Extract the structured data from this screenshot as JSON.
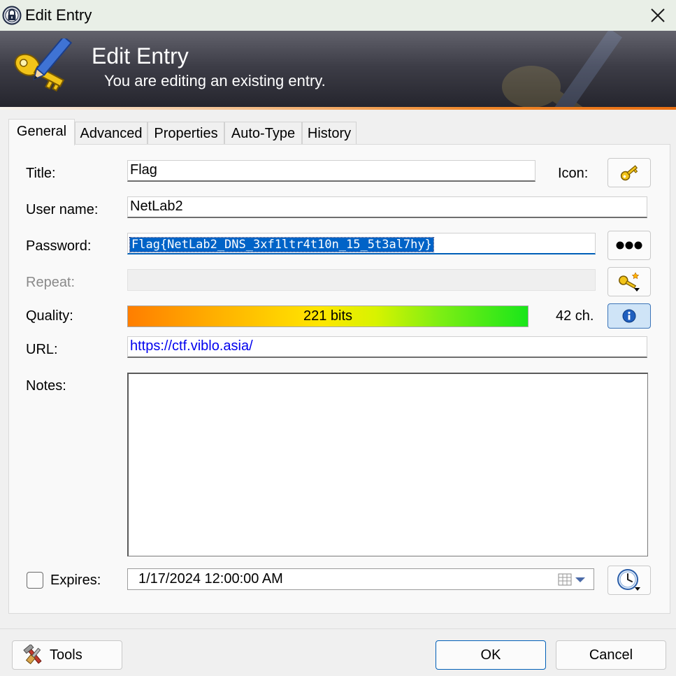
{
  "window": {
    "title": "Edit Entry"
  },
  "banner": {
    "title": "Edit Entry",
    "subtitle": "You are editing an existing entry."
  },
  "tabs": [
    {
      "label": "General",
      "active": true
    },
    {
      "label": "Advanced",
      "active": false
    },
    {
      "label": "Properties",
      "active": false
    },
    {
      "label": "Auto-Type",
      "active": false
    },
    {
      "label": "History",
      "active": false
    }
  ],
  "form": {
    "title_label": "Title:",
    "title_value": "Flag",
    "icon_label": "Icon:",
    "username_label": "User name:",
    "username_value": "NetLab2",
    "password_label": "Password:",
    "password_value": "Flag{NetLab2_DNS_3xf1ltr4t10n_15_5t3al7hy}",
    "repeat_label": "Repeat:",
    "repeat_value": "",
    "quality_label": "Quality:",
    "quality_bits": "221 bits",
    "quality_chars": "42 ch.",
    "url_label": "URL:",
    "url_value": "https://ctf.viblo.asia/",
    "notes_label": "Notes:",
    "notes_value": "",
    "expires_label": "Expires:",
    "expires_checked": false,
    "expires_value": "1/17/2024 12:00:00 AM"
  },
  "buttons": {
    "tools": "Tools",
    "ok": "OK",
    "cancel": "Cancel"
  },
  "colors": {
    "accent": "#005fb8",
    "url": "#0000ee",
    "selection": "#0063c7",
    "banner_dark": "#24242c"
  }
}
